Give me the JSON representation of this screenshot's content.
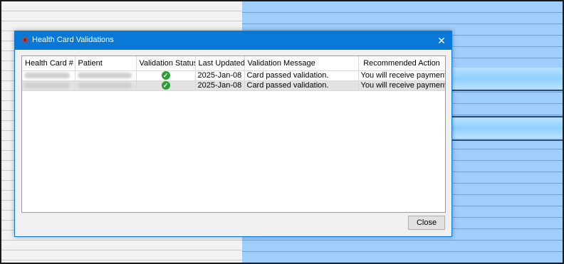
{
  "dialog": {
    "title": "Health Card Validations",
    "close_symbol": "✕",
    "close_button_label": "Close"
  },
  "table": {
    "columns": [
      "Health Card #",
      "Patient",
      "Validation Status",
      "Last Updated",
      "Validation Message",
      "Recommended Action"
    ],
    "rows": [
      {
        "status_icon": "check-circle-icon",
        "last_updated": "2025-Jan-08",
        "message": "Card passed validation.",
        "action": "You will receive payment for"
      },
      {
        "status_icon": "check-circle-icon",
        "last_updated": "2025-Jan-08",
        "message": "Card passed validation.",
        "action": "You will receive payment for"
      }
    ]
  },
  "colors": {
    "titlebar": "#0a78d7",
    "success": "#2e9f33"
  }
}
